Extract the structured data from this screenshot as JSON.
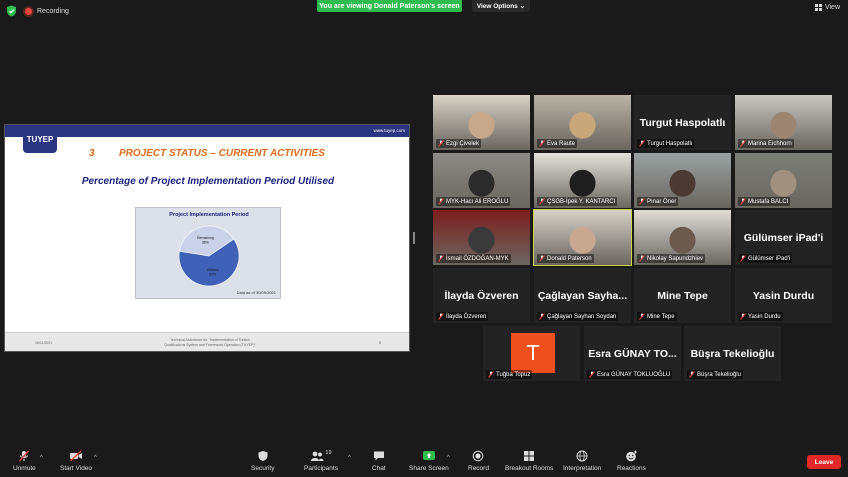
{
  "topbar": {
    "recording": "Recording",
    "viewing_banner": "You are viewing Donald Paterson's screen",
    "view_options": "View Options",
    "view_button": "View"
  },
  "slide": {
    "url": "www.tuyep.com",
    "logo": "TUYEP",
    "number": "3",
    "title": "PROJECT STATUS – CURRENT ACTIVITIES",
    "subtitle": "Percentage of Project Implementation Period Utilised",
    "footer_date": "16/11/2021",
    "footer_text_1": "Technical Assistance for \"Implementation of Turkish",
    "footer_text_2": "Qualifications System and Framework Operation (TUYEP)\"",
    "footer_page": "8"
  },
  "chart_data": {
    "type": "pie",
    "title": "Project Implementation Period",
    "labels": [
      "Remaining",
      "Utilized"
    ],
    "values": [
      38,
      62
    ],
    "value_labels": [
      "38%",
      "62%"
    ],
    "colors": [
      "#c9d2e8",
      "#3f62b8"
    ],
    "note": "Data as of 30/09/2021"
  },
  "participants": [
    {
      "name": "Ezgi Çivelek",
      "big": ""
    },
    {
      "name": "Eva Raute",
      "big": ""
    },
    {
      "name": "Turgut Haspolatlı",
      "big": "Turgut Haspolatlı"
    },
    {
      "name": "Marina Eichhorn",
      "big": ""
    },
    {
      "name": "MYK-Hacı Ali EROĞLU",
      "big": ""
    },
    {
      "name": "ÇSGB-İpek Y. KANTARCI",
      "big": ""
    },
    {
      "name": "Pınar Öner",
      "big": ""
    },
    {
      "name": "Mustafa BALCI",
      "big": ""
    },
    {
      "name": "İsmail ÖZDOĞAN-MYK",
      "big": ""
    },
    {
      "name": "Donald Paterson",
      "big": ""
    },
    {
      "name": "Nikolay Sapundzhiev",
      "big": ""
    },
    {
      "name": "Gülümser iPad'i",
      "big": "Gülümser iPad'i"
    },
    {
      "name": "İlayda Özveren",
      "big": "İlayda Özveren"
    },
    {
      "name": "Çağlayan Sayhan Soydan",
      "big": "Çağlayan Sayha..."
    },
    {
      "name": "Mine Tepe",
      "big": "Mine Tepe"
    },
    {
      "name": "Yasin Durdu",
      "big": "Yasin Durdu"
    },
    {
      "name": "Tuğba Topuz",
      "big": "",
      "avatar": "T"
    },
    {
      "name": "Esra GÜNAY TOKLUOĞLU",
      "big": "Esra GÜNAY TO..."
    },
    {
      "name": "Büşra Tekelioğlu",
      "big": "Büşra Tekelioğlu"
    }
  ],
  "toolbar": {
    "unmute": "Unmute",
    "start_video": "Start Video",
    "security": "Security",
    "participants": "Participants",
    "participants_count": "19",
    "chat": "Chat",
    "share_screen": "Share Screen",
    "record": "Record",
    "breakout_rooms": "Breakout Rooms",
    "interpretation": "Interpretation",
    "reactions": "Reactions",
    "leave": "Leave"
  },
  "colors": {
    "viewing_banner": "#2fbc4e",
    "leave": "#e02828",
    "active_speaker": "#c9d640",
    "mic_muted": "#e8473b",
    "slide_accent": "#e06b1a",
    "slide_navy": "#1a237e"
  }
}
